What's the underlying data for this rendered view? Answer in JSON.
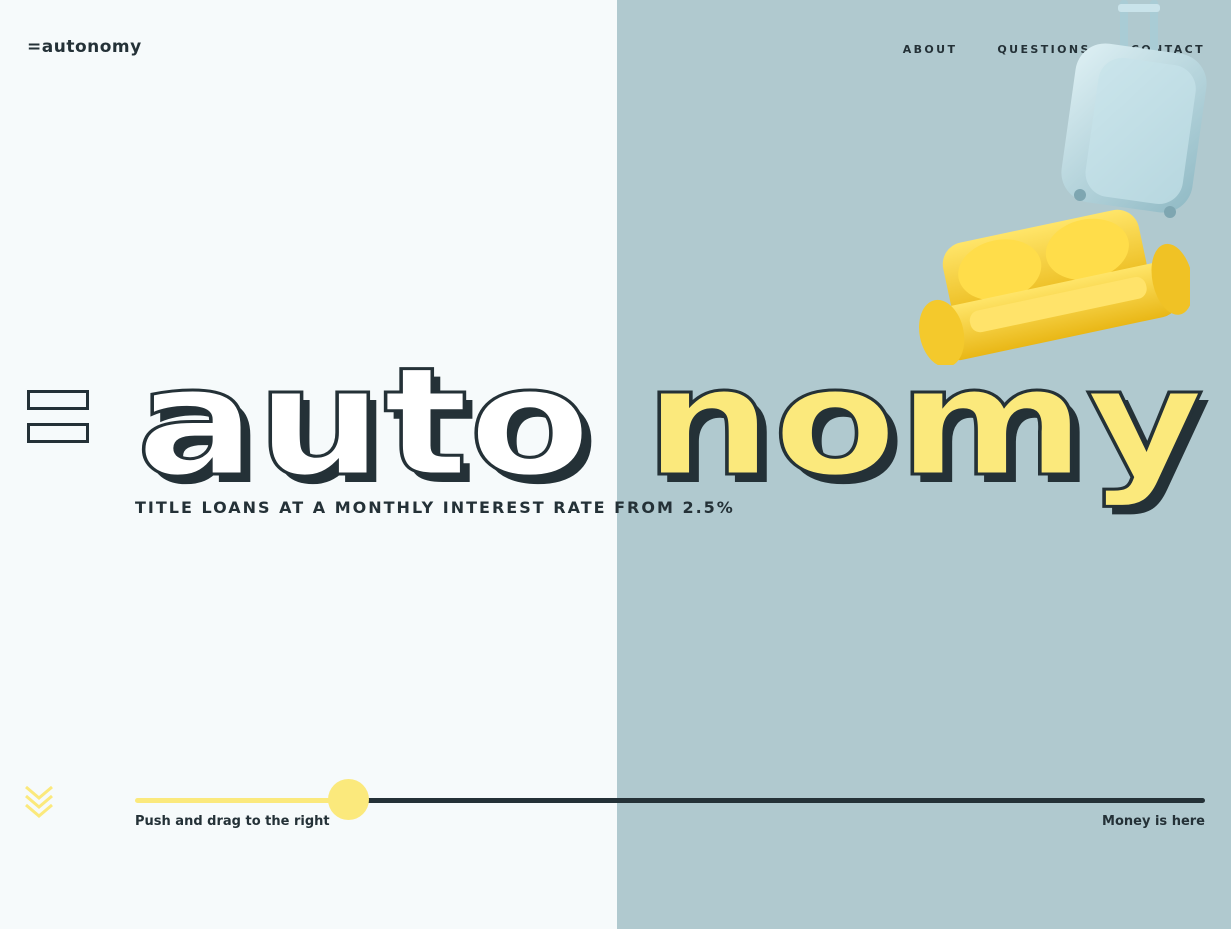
{
  "header": {
    "logo_text": "=autonomy",
    "nav": [
      {
        "label": "ABOUT"
      },
      {
        "label": "QUESTIONS"
      },
      {
        "label": "CONTACT"
      }
    ]
  },
  "hero": {
    "word_left": "auto",
    "word_right": "nomy",
    "tagline": "TITLE LOANS AT A MONTHLY INTEREST RATE FROM 2.5%"
  },
  "slider": {
    "left_hint": "Push and drag to the right",
    "right_hint": "Money is here",
    "progress": 0.2
  },
  "colors": {
    "bg_left": "#f6fafb",
    "bg_right": "#b0c9cf",
    "dark": "#243137",
    "yellow": "#fbe97c"
  },
  "icons": {
    "menu": "hamburger-icon",
    "scroll": "double-chevron-down-icon",
    "suitcase": "suitcase-illustration",
    "sofa": "sofa-illustration"
  }
}
